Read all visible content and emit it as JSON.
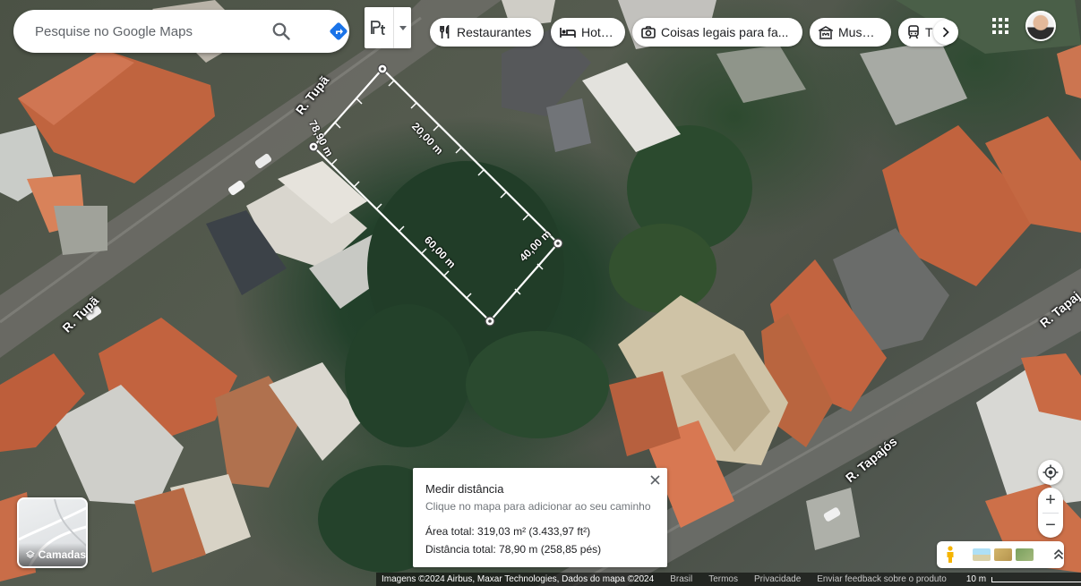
{
  "search": {
    "placeholder": "Pesquise no Google Maps"
  },
  "icons": {
    "search": "search-icon",
    "directions": "directions-icon",
    "measure_mode": "pt-measure-icon",
    "dropdown": "caret-down-icon",
    "apps": "apps-grid-icon",
    "layers": "layers-icon",
    "location": "my-location-icon",
    "pegman": "pegman-icon",
    "close": "close-icon",
    "expand": "chevron-up-icon"
  },
  "chips": [
    {
      "label": "Restaurantes",
      "icon": "fork-knife-icon"
    },
    {
      "label": "Hotéis",
      "icon": "bed-icon"
    },
    {
      "label": "Coisas legais para fa...",
      "icon": "camera-icon"
    },
    {
      "label": "Museus",
      "icon": "museum-icon"
    },
    {
      "label": "T",
      "icon": "train-icon"
    }
  ],
  "layers": {
    "label": "Camadas"
  },
  "map_labels": {
    "street_tupa_top": "R. Tupã",
    "street_tupa_left": "R. Tupã",
    "street_tapajos": "R. Tapajós",
    "street_tapajos_edge": "R. Tapaj"
  },
  "measure": {
    "segments": [
      "78,90 m",
      "20,00 m",
      "60,00 m",
      "40,00 m"
    ],
    "panel": {
      "title": "Medir distância",
      "hint": "Clique no mapa para adicionar ao seu caminho",
      "area": "Área total: 319,03 m² (3.433,97 ft²)",
      "distance": "Distância total: 78,90 m (258,85 pés)"
    }
  },
  "zoom": {
    "in": "+",
    "out": "−"
  },
  "attribution": {
    "imagery": "Imagens ©2024 Airbus, Maxar Technologies, Dados do mapa ©2024",
    "country": "Brasil",
    "terms": "Termos",
    "privacy": "Privacidade",
    "feedback": "Enviar feedback sobre o produto",
    "scale": "10 m"
  },
  "colors": {
    "accent_blue": "#1a73e8",
    "measure_line": "#ffffff",
    "roof": "#c0643f"
  }
}
